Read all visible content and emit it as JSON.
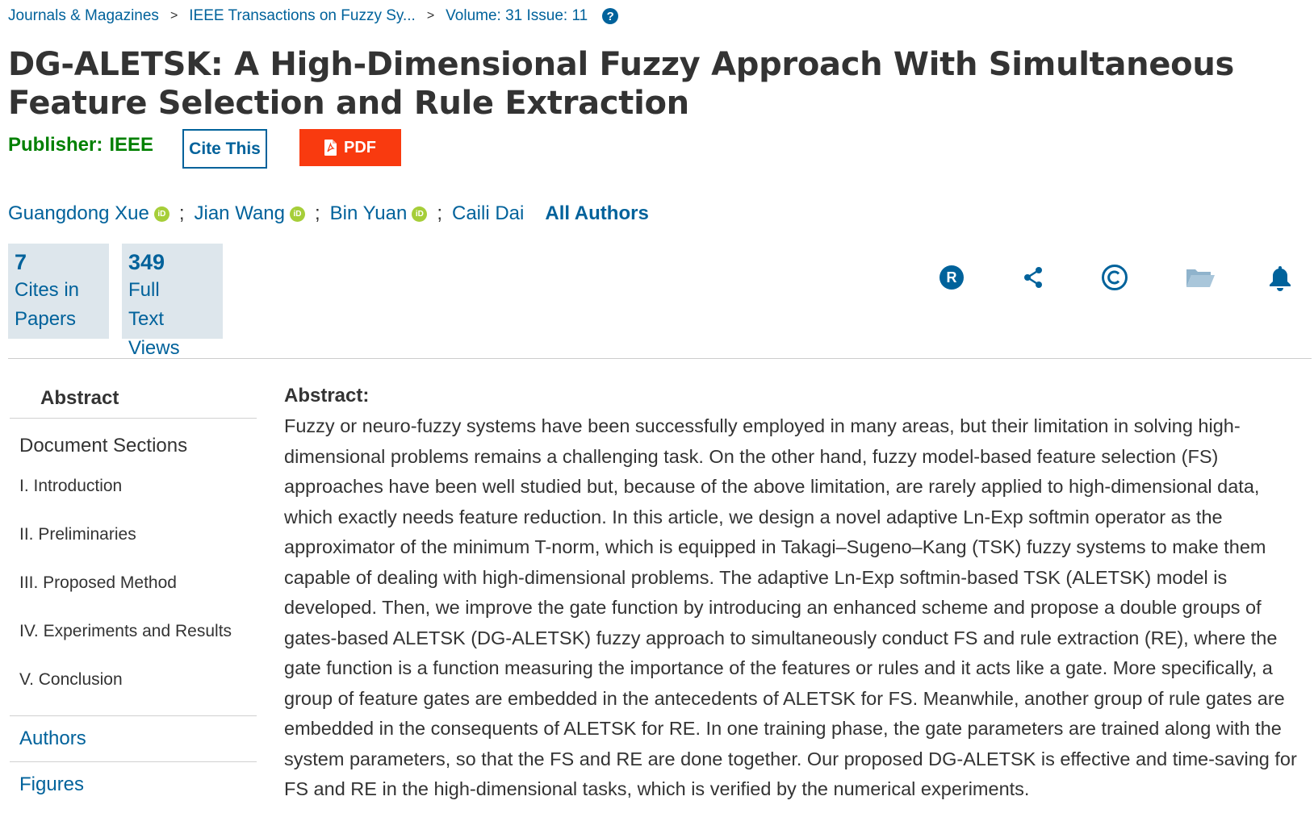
{
  "breadcrumb": {
    "items": [
      "Journals & Magazines",
      "IEEE Transactions on Fuzzy Sy...",
      "Volume: 31 Issue: 11"
    ],
    "separator": ">",
    "help_glyph": "?"
  },
  "document": {
    "title": "DG-ALETSK: A High-Dimensional Fuzzy Approach With Simultaneous Feature Selection and Rule Extraction",
    "publisher_label": "Publisher:",
    "publisher_value": "IEEE"
  },
  "actions": {
    "cite_label": "Cite This",
    "pdf_label": "PDF"
  },
  "authors": {
    "list": [
      "Guangdong Xue",
      "Jian Wang",
      "Bin Yuan",
      "Caili Dai"
    ],
    "separator": ";",
    "orcid_text": "iD",
    "all_authors_label": "All Authors"
  },
  "metrics": {
    "cites": {
      "value": "7",
      "label": "Cites in\nPapers"
    },
    "views": {
      "value": "349",
      "label": "Full\nText\nViews"
    }
  },
  "toolbar_icons": [
    "rights-icon",
    "share-icon",
    "copyright-icon",
    "folder-icon",
    "bell-icon"
  ],
  "sidebar": {
    "abstract_label": "Abstract",
    "doc_sections_label": "Document Sections",
    "sections": [
      "I.  Introduction",
      "II.  Preliminaries",
      "III.  Proposed Method",
      "IV.  Experiments and Results",
      "V.  Conclusion"
    ],
    "authors_link": "Authors",
    "figures_link": "Figures"
  },
  "abstract": {
    "heading": "Abstract:",
    "text": "Fuzzy or neuro-fuzzy systems have been successfully employed in many areas, but their limitation in solving high-dimensional problems remains a challenging task. On the other hand, fuzzy model-based feature selection (FS) approaches have been well studied but, because of the above limitation, are rarely applied to high-dimensional data, which exactly needs feature reduction. In this article, we design a novel adaptive Ln-Exp softmin operator as the approximator of the minimum T-norm, which is equipped in Takagi–Sugeno–Kang (TSK) fuzzy systems to make them capable of dealing with high-dimensional problems. The adaptive Ln-Exp softmin-based TSK (ALETSK) model is developed. Then, we improve the gate function by introducing an enhanced scheme and propose a double groups of gates-based ALETSK (DG-ALETSK) fuzzy approach to simultaneously conduct FS and rule extraction (RE), where the gate function is a function measuring the importance of the features or rules and it acts like a gate. More specifically, a group of feature gates are embedded in the antecedents of ALETSK for FS. Meanwhile, another group of rule gates are embedded in the consequents of ALETSK for RE. In one training phase, the gate parameters are trained along with the system parameters, so that the FS and RE are done together. Our proposed DG-ALETSK is effective and time-saving for FS and RE in the high-dimensional tasks, which is verified by the numerical experiments."
  },
  "colors": {
    "link": "#00629b",
    "publisher": "#008000",
    "pdf": "#f93a0f",
    "metric_bg": "#dde6ec",
    "orcid": "#a6ce39"
  }
}
